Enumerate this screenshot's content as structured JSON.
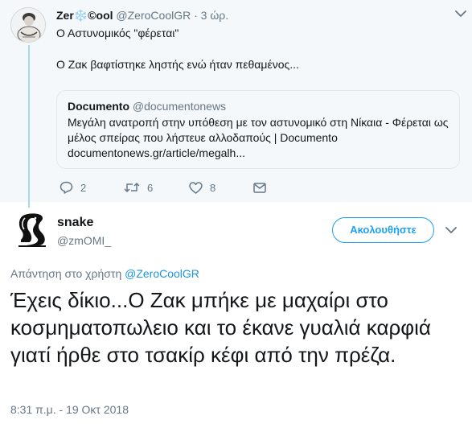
{
  "parent_tweet": {
    "display_name": "Zer❄️©ool",
    "handle": "@ZeroCoolGR",
    "separator": "·",
    "time_ago": "3 ώρ.",
    "text_line1": "Ο Αστυνομικός \"φέρεται\"",
    "text_line2": "Ο Ζακ βαφτίστηκε ληστής ενώ ήταν πεθαμένος...",
    "card": {
      "source_name": "Documento",
      "source_handle": "@documentonews",
      "description": "Μεγάλη ανατροπή στην υπόθεση με τον αστυνομικό στη Νίκαια - Φέρεται ως μέλος σπείρας που λήστευε αλλοδαπούς  | Documento",
      "url": "documentonews.gr/article/megalh..."
    },
    "actions": {
      "reply_icon": "reply-icon",
      "reply_count": "2",
      "retweet_icon": "retweet-icon",
      "retweet_count": "6",
      "like_icon": "like-icon",
      "like_count": "8",
      "dm_icon": "direct-message-icon"
    }
  },
  "main_tweet": {
    "display_name": "snake",
    "handle": "@zmOMI_",
    "follow_label": "Ακολουθήστε",
    "reply_to_label": "Απάντηση στο χρήστη",
    "reply_to_user": "@ZeroCoolGR",
    "text": "Έχεις δίκιο...Ο Ζακ μπήκε με μαχαίρι στο κοσμηματοπωλειο και το έκανε γυαλιά καρφιά γιατί ήρθε στο τσακίρ κέφι από την πρέζα.",
    "timestamp": "8:31 π.μ. - 19 Οκτ 2018"
  },
  "colors": {
    "accent": "#1da1f2",
    "link": "#1b95e0",
    "muted": "#657786",
    "text": "#14171a",
    "thread_line": "#a8d6f4",
    "parent_bg": "#f5f8fa"
  }
}
